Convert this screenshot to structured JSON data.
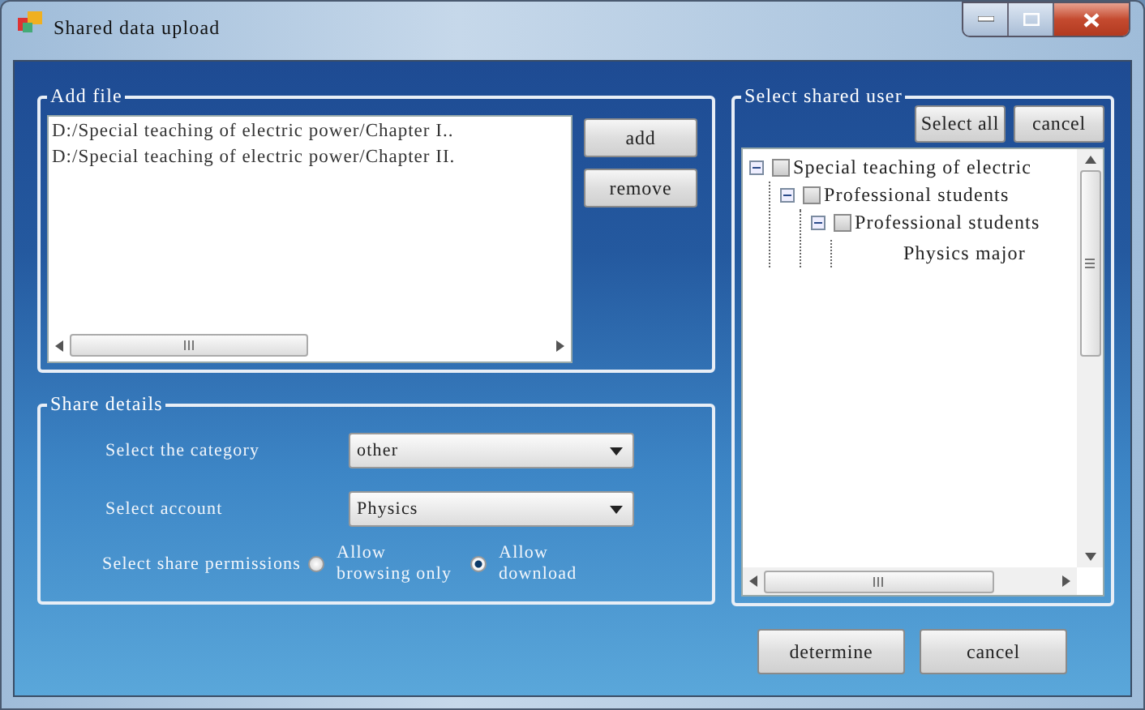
{
  "window": {
    "title": "Shared data upload"
  },
  "add_file": {
    "title": "Add file",
    "files": [
      "D:/Special teaching of electric power/Chapter I..",
      "D:/Special teaching of electric power/Chapter II."
    ],
    "buttons": [
      "add",
      "remove"
    ]
  },
  "share_details": {
    "title": "Share details",
    "category": {
      "label": "Select the category",
      "value": "other"
    },
    "account": {
      "label": "Select account",
      "value": "Physics"
    },
    "permissions": {
      "label": "Select share permissions",
      "options": [
        {
          "label": "Allow browsing only",
          "selected": false
        },
        {
          "label": "Allow download",
          "selected": true
        }
      ]
    }
  },
  "shared_user": {
    "title": "Select shared user",
    "buttons": [
      "Select all",
      "cancel"
    ],
    "tree": [
      {
        "label": "Special teaching of electric",
        "checked": false,
        "expanded": true,
        "children": [
          {
            "label": "Professional students",
            "checked": false,
            "expanded": true,
            "children": [
              {
                "label": "Professional students",
                "checked": false,
                "expanded": true,
                "children": [
                  {
                    "label": "Physics major"
                  }
                ]
              }
            ]
          }
        ]
      }
    ]
  },
  "buttons": [
    "determine",
    "cancel"
  ]
}
